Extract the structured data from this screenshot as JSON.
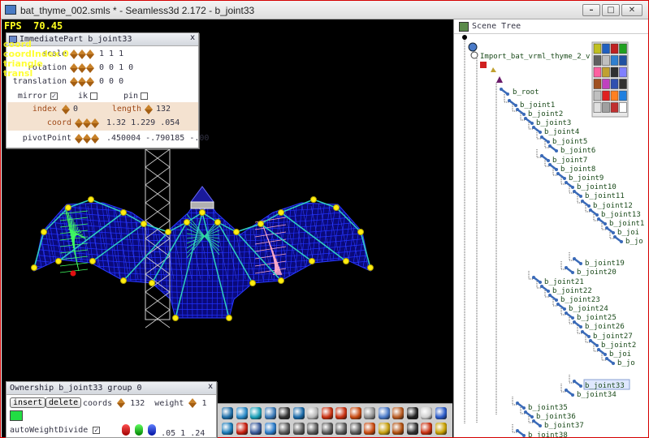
{
  "window": {
    "title": "bat_thyme_002.smls * - Seamless3d 2.172 - b_joint33",
    "min": "–",
    "max": "□",
    "close": "✕"
  },
  "viewport": {
    "fps_label": "FPS",
    "fps_value": "70.45",
    "overlay_lines": [
      "coord",
      "coordIndex 0",
      "triangle",
      "transl"
    ]
  },
  "immediate_part": {
    "title": "ImmediatePart b_joint33",
    "close": "x",
    "scale": {
      "label": "scale",
      "value": "1 1 1"
    },
    "rotation": {
      "label": "rotation",
      "value": "0 0 1 0"
    },
    "translation": {
      "label": "translation",
      "value": "0 0 0"
    },
    "mirror": {
      "label": "mirror",
      "checked": "✓"
    },
    "ik": {
      "label": "ik"
    },
    "pin": {
      "label": "pin"
    },
    "index": {
      "label": "index",
      "value": "0"
    },
    "length": {
      "label": "length",
      "value": "132"
    },
    "coord": {
      "label": "coord",
      "value": "1.32 1.229 .054"
    },
    "pivot": {
      "label": "pivotPoint",
      "value": ".450004 -.790185 -.00"
    }
  },
  "ownership": {
    "title": "Ownership b_joint33 group 0",
    "close": "x",
    "insert": "insert",
    "delete": "delete",
    "coords_label": "coords",
    "coords_value": "132",
    "weight_label": "weight",
    "weight_value": "1",
    "swatch_color": "#22dd44",
    "auto_label": "autoWeightDivide",
    "auto_checked": "✓",
    "auto_values": ".05 1 .24"
  },
  "toolbar": {
    "icons": [
      "rotate-icon",
      "sphere-icon",
      "sphere-icon",
      "sphere-icon",
      "bat-icon",
      "sphere-icon",
      "grid-icon",
      "joint-icon",
      "move-icon",
      "undo-icon",
      "box-icon",
      "crosshair-icon",
      "crosshair-icon",
      "moon-icon",
      "bone-icon",
      "help-icon",
      "refresh-icon",
      "no-icon",
      "xyz-icon",
      "move-icon",
      "cube-icon",
      "triangle-icon",
      "triangle-icon",
      "triangle-icon",
      "triangle-icon",
      "triangle-icon",
      "pin-icon",
      "star-icon",
      "brush-icon",
      "scissors-icon",
      "fire-icon",
      "color-wheel-icon"
    ]
  },
  "tree": {
    "title": "Scene Tree",
    "import_label": "Import_bat_vrml_thyme_2_v",
    "root_label": "b_root",
    "nodes": [
      {
        "label": "b_joint1"
      },
      {
        "label": "b_joint2"
      },
      {
        "label": "b_joint3"
      },
      {
        "label": "b_joint4"
      },
      {
        "label": "b_joint5"
      },
      {
        "label": "b_joint6"
      },
      {
        "label": "b_joint7"
      },
      {
        "label": "b_joint8"
      },
      {
        "label": "b_joint9"
      },
      {
        "label": "b_joint10"
      },
      {
        "label": "b_joint11"
      },
      {
        "label": "b_joint12"
      },
      {
        "label": "b_joint13"
      },
      {
        "label": "b_joint1"
      },
      {
        "label": "b_joi"
      },
      {
        "label": "b_jo"
      },
      {
        "label": "b_joint19"
      },
      {
        "label": "b_joint20"
      },
      {
        "label": "b_joint21"
      },
      {
        "label": "b_joint22"
      },
      {
        "label": "b_joint23"
      },
      {
        "label": "b_joint24"
      },
      {
        "label": "b_joint25"
      },
      {
        "label": "b_joint26"
      },
      {
        "label": "b_joint27"
      },
      {
        "label": "b_joint2"
      },
      {
        "label": "b_joi"
      },
      {
        "label": "b_jo"
      },
      {
        "label": "b_joint33"
      },
      {
        "label": "b_joint34"
      },
      {
        "label": "b_joint35"
      },
      {
        "label": "b_joint36"
      },
      {
        "label": "b_joint37"
      },
      {
        "label": "b_joint38"
      }
    ]
  }
}
